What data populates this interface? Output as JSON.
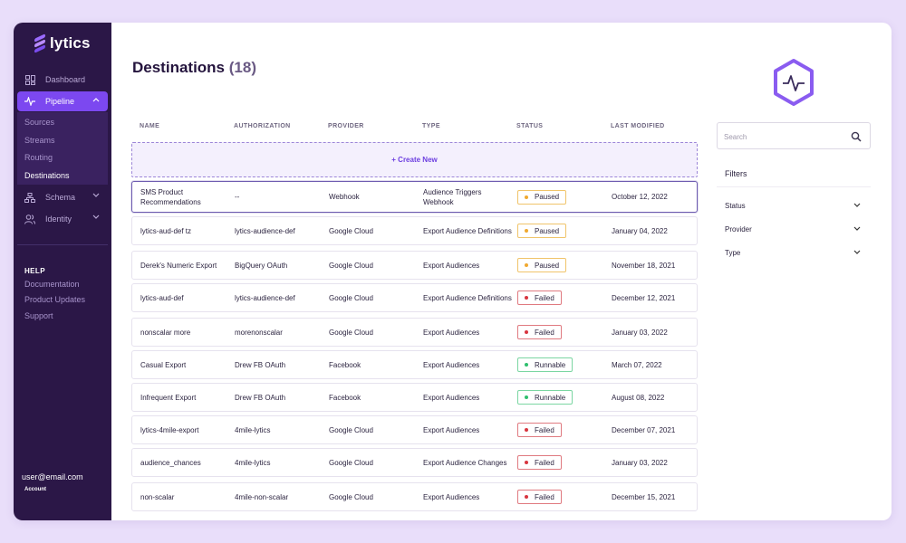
{
  "brand": {
    "name": "lytics"
  },
  "sidebar": {
    "nav": [
      {
        "label": "Dashboard",
        "icon": "grid-icon"
      },
      {
        "label": "Pipeline",
        "icon": "pulse-icon"
      },
      {
        "label": "Schema",
        "icon": "hierarchy-icon"
      },
      {
        "label": "Identity",
        "icon": "users-icon"
      }
    ],
    "pipeline_sub": [
      "Sources",
      "Streams",
      "Routing",
      "Destinations"
    ],
    "help_title": "HELP",
    "help_items": [
      "Documentation",
      "Product Updates",
      "Support"
    ],
    "user_email": "user@email.com",
    "account_label": "Account"
  },
  "page": {
    "title": "Destinations",
    "count": "(18)"
  },
  "table": {
    "headers": [
      "NAME",
      "AUTHORIZATION",
      "PROVIDER",
      "TYPE",
      "STATUS",
      "LAST MODIFIED"
    ],
    "create_label": "+ Create New",
    "rows": [
      {
        "name": "SMS Product Recommendations",
        "auth": "--",
        "provider": "Webhook",
        "type": "Audience Triggers Webhook",
        "status": "Paused",
        "modified": "October 12, 2022"
      },
      {
        "name": "lytics-aud-def tz",
        "auth": "lytics-audience-def",
        "provider": "Google Cloud",
        "type": "Export Audience Definitions",
        "status": "Paused",
        "modified": "January 04, 2022"
      },
      {
        "name": "Derek's Numeric Export",
        "auth": "BigQuery OAuth",
        "provider": "Google Cloud",
        "type": "Export Audiences",
        "status": "Paused",
        "modified": "November 18, 2021"
      },
      {
        "name": "lytics-aud-def",
        "auth": "lytics-audience-def",
        "provider": "Google Cloud",
        "type": "Export Audience Definitions",
        "status": "Failed",
        "modified": "December 12, 2021"
      },
      {
        "name": "nonscalar more",
        "auth": "morenonscalar",
        "provider": "Google Cloud",
        "type": "Export Audiences",
        "status": "Failed",
        "modified": "January 03, 2022"
      },
      {
        "name": "Casual Export",
        "auth": "Drew FB OAuth",
        "provider": "Facebook",
        "type": "Export Audiences",
        "status": "Runnable",
        "modified": "March 07, 2022"
      },
      {
        "name": "Infrequent Export",
        "auth": "Drew FB OAuth",
        "provider": "Facebook",
        "type": "Export Audiences",
        "status": "Runnable",
        "modified": "August 08, 2022"
      },
      {
        "name": "lytics-4mile-export",
        "auth": "4mile-lytics",
        "provider": "Google Cloud",
        "type": "Export Audiences",
        "status": "Failed",
        "modified": "December 07, 2021"
      },
      {
        "name": "audience_chances",
        "auth": "4mile-lytics",
        "provider": "Google Cloud",
        "type": "Export Audience Changes",
        "status": "Failed",
        "modified": "January 03, 2022"
      },
      {
        "name": "non-scalar",
        "auth": "4mile-non-scalar",
        "provider": "Google Cloud",
        "type": "Export Audiences",
        "status": "Failed",
        "modified": "December 15, 2021"
      }
    ]
  },
  "search": {
    "placeholder": "Search",
    "value": ""
  },
  "filters": {
    "title": "Filters",
    "items": [
      "Status",
      "Provider",
      "Type"
    ]
  },
  "colors": {
    "sidebar_bg": "#2b1747",
    "accent": "#7c48f0",
    "paused": "#f0a930",
    "failed": "#d8353f",
    "runnable": "#2fbf6e"
  }
}
